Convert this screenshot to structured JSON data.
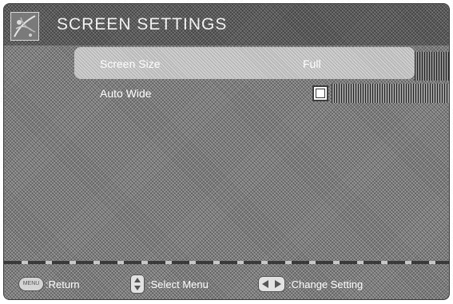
{
  "header": {
    "title": "SCREEN SETTINGS",
    "icon": "settings-pattern-icon"
  },
  "menu": {
    "items": [
      {
        "label": "Screen Size",
        "value": "Full",
        "selected": true
      },
      {
        "label": "Auto Wide",
        "value": "",
        "control": "checkbox",
        "checked": false
      }
    ]
  },
  "footer": {
    "menu_button_label": "MENU",
    "return_label": ":Return",
    "select_label": ":Select Menu",
    "change_label": ":Change Setting"
  },
  "colors": {
    "background": "#7c7c7c",
    "highlight": "#b9b9b9",
    "text": "#ffffff"
  }
}
